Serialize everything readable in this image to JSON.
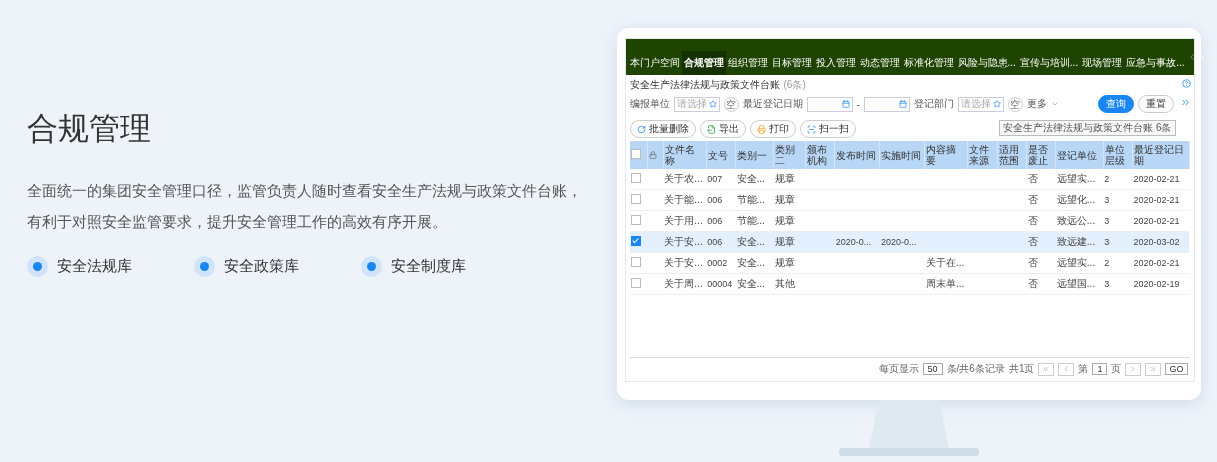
{
  "hero": {
    "title": "合规管理",
    "description": [
      "全面统一的集团安全管理口径，监管负责人随时查看安全生产法规与政策文件台账，",
      "有利于对照安全监管要求，提升安全管理工作的高效有序开展。"
    ],
    "features": [
      "安全法规库",
      "安全政策库",
      "安全制度库"
    ]
  },
  "app": {
    "nav": [
      {
        "label": "本门户空间",
        "selected": false
      },
      {
        "label": "合规管理",
        "selected": true
      },
      {
        "label": "组织管理",
        "selected": false
      },
      {
        "label": "目标管理",
        "selected": false
      },
      {
        "label": "投入管理",
        "selected": false
      },
      {
        "label": "动态管理",
        "selected": false
      },
      {
        "label": "标准化管理",
        "selected": false
      },
      {
        "label": "风险与隐患...",
        "selected": false
      },
      {
        "label": "宣传与培训...",
        "selected": false
      },
      {
        "label": "现场管理",
        "selected": false
      },
      {
        "label": "应急与事故...",
        "selected": false
      }
    ],
    "page_title": "安全生产法律法规与政策文件台账",
    "page_count": "(6条)",
    "filters": [
      {
        "kind": "select",
        "label": "编报单位",
        "placeholder": "请选择",
        "clear": "空"
      },
      {
        "kind": "date_range",
        "label": "最近登记日期",
        "separator": "-"
      },
      {
        "kind": "select",
        "label": "登记部门",
        "placeholder": "请选择",
        "clear": "空"
      }
    ],
    "more": "更多",
    "search_button": "查询",
    "reset_button": "重置",
    "tooltip": "安全生产法律法规与政策文件台账 6条",
    "toolbar": [
      {
        "kind": "refresh",
        "label": "批量删除"
      },
      {
        "kind": "export",
        "label": "导出"
      },
      {
        "kind": "print",
        "label": "打印"
      },
      {
        "kind": "scan",
        "label": "扫一扫"
      }
    ],
    "table": {
      "all_checked": false,
      "columns": [
        "文件名称",
        "文号",
        "类别一",
        "类别二",
        "颁布机构",
        "发布时间",
        "实施时间",
        "内容摘要",
        "文件来源",
        "适用范围",
        "是否废止",
        "登记单位",
        "单位层级",
        "最近登记日期"
      ],
      "rows": [
        {
          "checked": false,
          "cells": [
            "关于农...",
            "007",
            "安全...",
            "规章",
            "",
            "",
            "",
            "",
            "",
            "",
            "否",
            "远望实...",
            "2",
            "2020-02-21"
          ]
        },
        {
          "checked": false,
          "cells": [
            "关于能...",
            "006",
            "节能...",
            "规章",
            "",
            "",
            "",
            "",
            "",
            "",
            "否",
            "远望化...",
            "3",
            "2020-02-21"
          ]
        },
        {
          "checked": false,
          "cells": [
            "关于用...",
            "006",
            "节能...",
            "规章",
            "",
            "",
            "",
            "",
            "",
            "",
            "否",
            "致远公...",
            "3",
            "2020-02-21"
          ]
        },
        {
          "checked": true,
          "cells": [
            "关于安...",
            "006",
            "安全...",
            "规章",
            "",
            "2020-0...",
            "2020-0...",
            "",
            "",
            "",
            "否",
            "致远建...",
            "3",
            "2020-03-02"
          ]
        },
        {
          "checked": false,
          "cells": [
            "关于安...",
            "0002",
            "安全...",
            "规章",
            "",
            "",
            "",
            "关于在...",
            "",
            "",
            "否",
            "远望实...",
            "2",
            "2020-02-21"
          ]
        },
        {
          "checked": false,
          "cells": [
            "关于周...",
            "00004",
            "安全...",
            "其他",
            "",
            "",
            "",
            "周末单...",
            "",
            "",
            "否",
            "远望国...",
            "3",
            "2020-02-19"
          ]
        }
      ]
    },
    "pagination": {
      "per_page_label": "每页显示",
      "per_page": "50",
      "total": "条/共6条记录",
      "pages": "共1页",
      "page_prefix": "第",
      "page": "1",
      "page_suffix": "页",
      "go": "GO"
    }
  }
}
